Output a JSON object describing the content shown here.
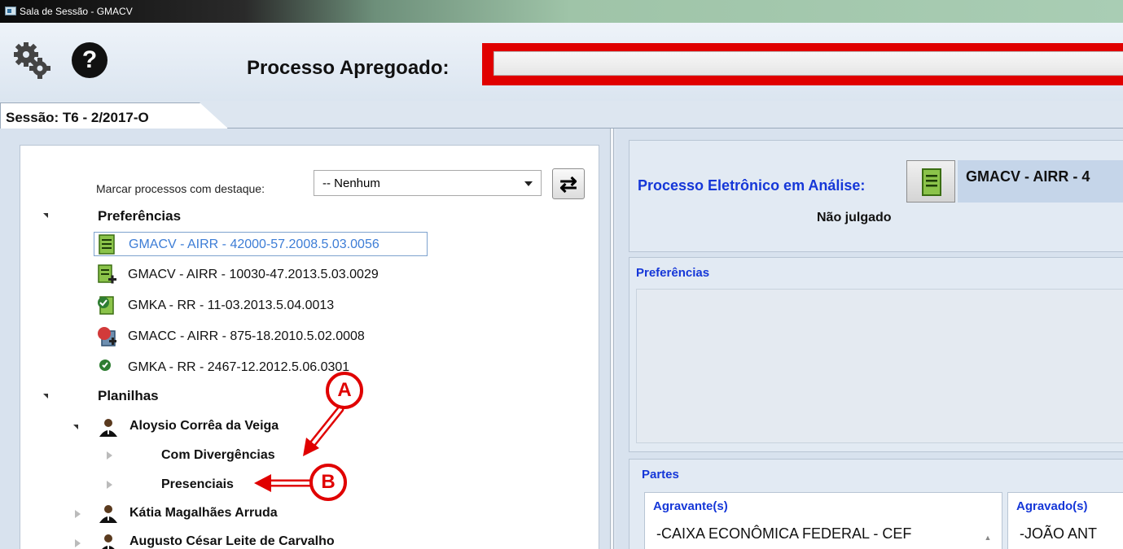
{
  "window": {
    "title": "Sala de Sessão - GMACV"
  },
  "toolbar": {
    "apregoado_label": "Processo Apregoado:",
    "apregoado_value": ""
  },
  "session_tab": {
    "label": "Sessão: T6 - 2/2017-O"
  },
  "left": {
    "highlight_label": "Marcar processos com destaque:",
    "highlight_value": "-- Nenhum",
    "groups": {
      "preferencias": "Preferências",
      "planilhas": "Planilhas"
    },
    "processes": [
      "GMACV - AIRR - 42000-57.2008.5.03.0056",
      "GMACV - AIRR - 10030-47.2013.5.03.0029",
      "GMKA - RR - 11-03.2013.5.04.0013",
      "GMACC - AIRR - 875-18.2010.5.02.0008",
      "GMKA - RR - 2467-12.2012.5.06.0301"
    ],
    "ministers": [
      {
        "name": "Aloysio Corrêa da Veiga",
        "children": [
          "Com Divergências",
          "Presenciais"
        ]
      },
      {
        "name": "Kátia Magalhães Arruda"
      },
      {
        "name": "Augusto César Leite de Carvalho"
      }
    ]
  },
  "right": {
    "analise_label": "Processo Eletrônico em Análise:",
    "analise_value": "GMACV - AIRR - 4",
    "status": "Não julgado",
    "preferencias_header": "Preferências",
    "partes_header": "Partes",
    "agravante_header": "Agravante(s)",
    "agravante_value": "-CAIXA ECONÔMICA FEDERAL - CEF",
    "agravado_header": "Agravado(s)",
    "agravado_value": "-JOÃO ANT"
  },
  "annotations": {
    "a": "A",
    "b": "B"
  },
  "colors": {
    "accent_blue": "#1537d8",
    "selected_text": "#3d7dd6",
    "annotation_red": "#e00000"
  }
}
